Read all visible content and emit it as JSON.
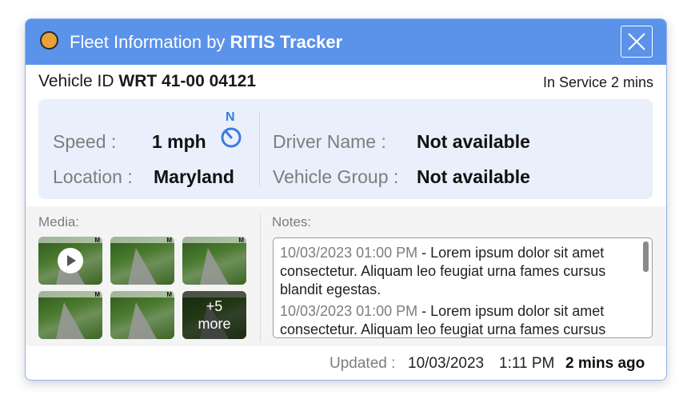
{
  "header": {
    "title_prefix": "Fleet Information by",
    "title_brand": "RITIS Tracker",
    "status_color": "#e9a13b",
    "accent_color": "#5b92ea",
    "close_icon": "close-icon"
  },
  "vehicle": {
    "id_label": "Vehicle ID",
    "id_value": "WRT 41-00 04121",
    "service_status": "In Service 2 mins"
  },
  "info": {
    "speed_label": "Speed :",
    "speed_value": "1 mph",
    "heading": "N",
    "location_label": "Location :",
    "location_value": "Maryland",
    "driver_label": "Driver Name :",
    "driver_value": "Not available",
    "group_label": "Vehicle Group :",
    "group_value": "Not available"
  },
  "media": {
    "label": "Media:",
    "thumbnail_tag": "M",
    "more_count": "+5",
    "more_text": "more"
  },
  "notes": {
    "label": "Notes:",
    "items": [
      {
        "timestamp": "10/03/2023 01:00 PM",
        "text": " - Lorem ipsum dolor sit amet consectetur. Aliquam leo feugiat urna fames cursus blandit egestas."
      },
      {
        "timestamp": "10/03/2023 01:00 PM",
        "text": " - Lorem ipsum dolor sit amet consectetur. Aliquam leo feugiat urna fames cursus"
      }
    ]
  },
  "footer": {
    "updated_label": "Updated :",
    "date": "10/03/2023",
    "time": "1:11 PM",
    "ago": "2 mins ago"
  }
}
